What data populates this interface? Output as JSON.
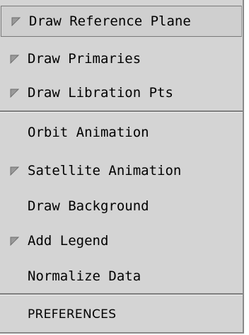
{
  "menu": {
    "items": [
      {
        "label": "Draw Reference Plane",
        "checked": true
      },
      {
        "label": "Draw Primaries",
        "checked": true
      },
      {
        "label": "Draw Libration Pts",
        "checked": true
      },
      {
        "label": "Orbit Animation",
        "checked": false
      },
      {
        "label": "Satellite Animation",
        "checked": true
      },
      {
        "label": "Draw Background",
        "checked": false
      },
      {
        "label": "Add Legend",
        "checked": true
      },
      {
        "label": "Normalize Data",
        "checked": false
      },
      {
        "label": "PREFERENCES",
        "checked": false
      }
    ]
  },
  "colors": {
    "menu_background": "#d4d4d4",
    "check_mark": "#9a9a9a"
  }
}
